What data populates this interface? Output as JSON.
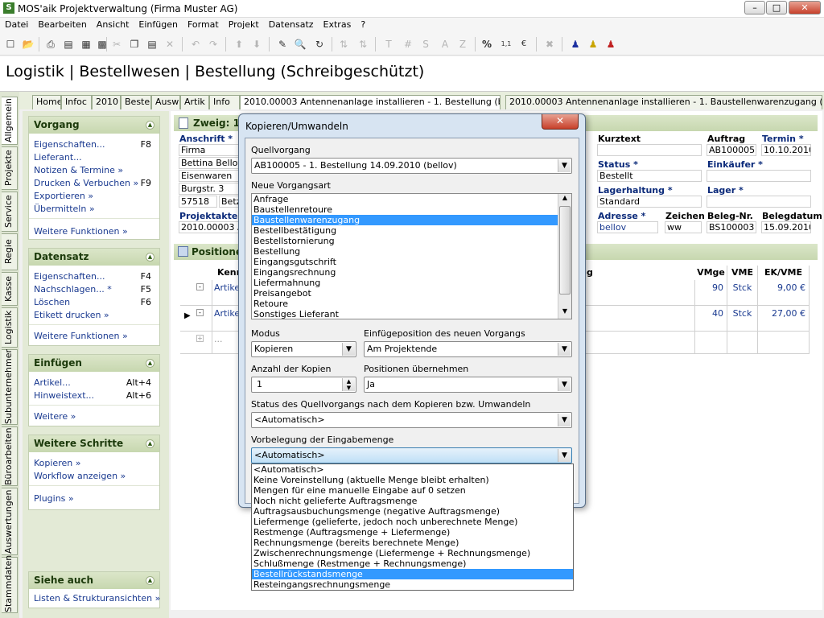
{
  "window": {
    "title": "MOS'aik Projektverwaltung (Firma Muster AG)",
    "app_icon": "S"
  },
  "menu": [
    "Datei",
    "Bearbeiten",
    "Ansicht",
    "Einfügen",
    "Format",
    "Projekt",
    "Datensatz",
    "Extras",
    "?"
  ],
  "page_title": "Logistik | Bestellwesen | Bestellung (Schreibgeschützt)",
  "vertical_tabs": [
    "Allgemein",
    "Projekte",
    "Service",
    "Regie",
    "Kasse",
    "Logistik",
    "Subunternehmer",
    "Büroarbeiten",
    "Auswertungen",
    "Stammdaten"
  ],
  "doc_tabs": [
    "Home",
    "Infoc",
    "2010",
    "Beste",
    "Ausw",
    "Artik",
    "Info",
    "2010.00003 Antennenanlage installieren - 1. Bestellung (bellov)",
    "2010.00003 Antennenanlage installieren - 1. Baustellenwarenzugang (bellov)"
  ],
  "left_panel": {
    "vorgang": {
      "title": "Vorgang",
      "items": [
        {
          "label": "Eigenschaften...",
          "key": "F8"
        },
        {
          "label": "Lieferant...",
          "key": ""
        },
        {
          "label": "Notizen & Termine »",
          "key": ""
        },
        {
          "label": "Drucken & Verbuchen »",
          "key": "F9"
        },
        {
          "label": "Exportieren »",
          "key": ""
        },
        {
          "label": "Übermitteln »",
          "key": ""
        }
      ],
      "more": "Weitere Funktionen »"
    },
    "datensatz": {
      "title": "Datensatz",
      "items": [
        {
          "label": "Eigenschaften...",
          "key": "F4"
        },
        {
          "label": "Nachschlagen... *",
          "key": "F5"
        },
        {
          "label": "Löschen",
          "key": "F6"
        },
        {
          "label": "Etikett drucken »",
          "key": ""
        }
      ],
      "more": "Weitere Funktionen »"
    },
    "einfuegen": {
      "title": "Einfügen",
      "items": [
        {
          "label": "Artikel...",
          "key": "Alt+4"
        },
        {
          "label": "Hinweistext...",
          "key": "Alt+6"
        }
      ],
      "more": "Weitere »"
    },
    "weitere": {
      "title": "Weitere Schritte",
      "items": [
        {
          "label": "Kopieren »",
          "key": ""
        },
        {
          "label": "Workflow anzeigen »",
          "key": ""
        }
      ],
      "more": "Plugins »"
    },
    "siehe": {
      "title": "Siehe auch",
      "items": [
        {
          "label": "Listen & Strukturansichten »",
          "key": ""
        }
      ]
    }
  },
  "zweig": {
    "title": "Zweig: 1. B"
  },
  "form": {
    "anschrift_label": "Anschrift *",
    "anschrift": [
      "Firma",
      "Bettina Bellov &",
      "Eisenwaren",
      "Burgstr. 3",
      "57518",
      "Betz"
    ],
    "projektakte_label": "Projektakte",
    "projektakte": "2010.00003 An",
    "kurztext_label": "Kurztext",
    "auftrag_label": "Auftrag",
    "auftrag": "AB100005",
    "termin_label": "Termin *",
    "termin": "10.10.2010",
    "status_label": "Status *",
    "status": "Bestellt",
    "einkaeufer_label": "Einkäufer *",
    "lagerhaltung_label": "Lagerhaltung *",
    "lagerhaltung": "Standard",
    "lager_label": "Lager *",
    "adresse_label": "Adresse *",
    "adresse": "bellov",
    "zeichen_label": "Zeichen",
    "zeichen": "ww",
    "belegnr_label": "Beleg-Nr.",
    "belegnr": "BS100003",
    "belegdatum_label": "Belegdatum",
    "belegdatum": "15.09.2010"
  },
  "positions": {
    "title": "Positionen",
    "headers": {
      "kenn": "Kenn",
      "g": "g",
      "vmge": "VMge",
      "vme": "VME",
      "ekvme": "EK/VME"
    },
    "rows": [
      {
        "kenn": "Artikel",
        "vmge": "90",
        "vme": "Stck",
        "ek": "9,00 €"
      },
      {
        "kenn": "Artikel",
        "vmge": "40",
        "vme": "Stck",
        "ek": "27,00 €"
      },
      {
        "kenn": "...",
        "vmge": "",
        "vme": "",
        "ek": ""
      }
    ]
  },
  "dialog": {
    "title": "Kopieren/Umwandeln",
    "quellvorgang_label": "Quellvorgang",
    "quellvorgang": "AB100005 - 1. Bestellung 14.09.2010 (bellov)",
    "neue_label": "Neue Vorgangsart",
    "neue_items": [
      "Anfrage",
      "Baustellenretoure",
      "Baustellenwarenzugang",
      "Bestellbestätigung",
      "Bestellstornierung",
      "Bestellung",
      "Eingangsgutschrift",
      "Eingangsrechnung",
      "Liefermahnung",
      "Preisangebot",
      "Retoure",
      "Sonstiges Lieferant"
    ],
    "neue_selected": 2,
    "modus_label": "Modus",
    "modus": "Kopieren",
    "einfuegepos_label": "Einfügeposition des neuen Vorgangs",
    "einfuegepos": "Am Projektende",
    "anzahl_label": "Anzahl der Kopien",
    "anzahl": "1",
    "positionen_label": "Positionen übernehmen",
    "positionen": "Ja",
    "status_label": "Status des Quellvorgangs nach dem Kopieren bzw. Umwandeln",
    "status": "<Automatisch>",
    "vorbelegung_label": "Vorbelegung der Eingabemenge",
    "vorbelegung": "<Automatisch>",
    "dropdown_items": [
      "<Automatisch>",
      "Keine Voreinstellung (aktuelle Menge bleibt erhalten)",
      "Mengen für eine manuelle Eingabe auf 0 setzen",
      "Noch nicht gelieferte Auftragsmenge",
      "Auftragsausbuchungsmenge (negative Auftragsmenge)",
      "Liefermenge (gelieferte, jedoch noch unberechnete Menge)",
      "Restmenge (Auftragsmenge + Liefermenge)",
      "Rechnungsmenge (bereits berechnete Menge)",
      "Zwischenrechnungsmenge (Liefermenge + Rechnungsmenge)",
      "Schlußmenge (Restmenge + Rechnungsmenge)",
      "Bestellrückstandsmenge",
      "Resteingangsrechnungsmenge"
    ],
    "dropdown_selected": 10
  },
  "colors": {
    "accent_green": "#c7d7af",
    "link_blue": "#1a3a90",
    "selection": "#3399ff"
  }
}
